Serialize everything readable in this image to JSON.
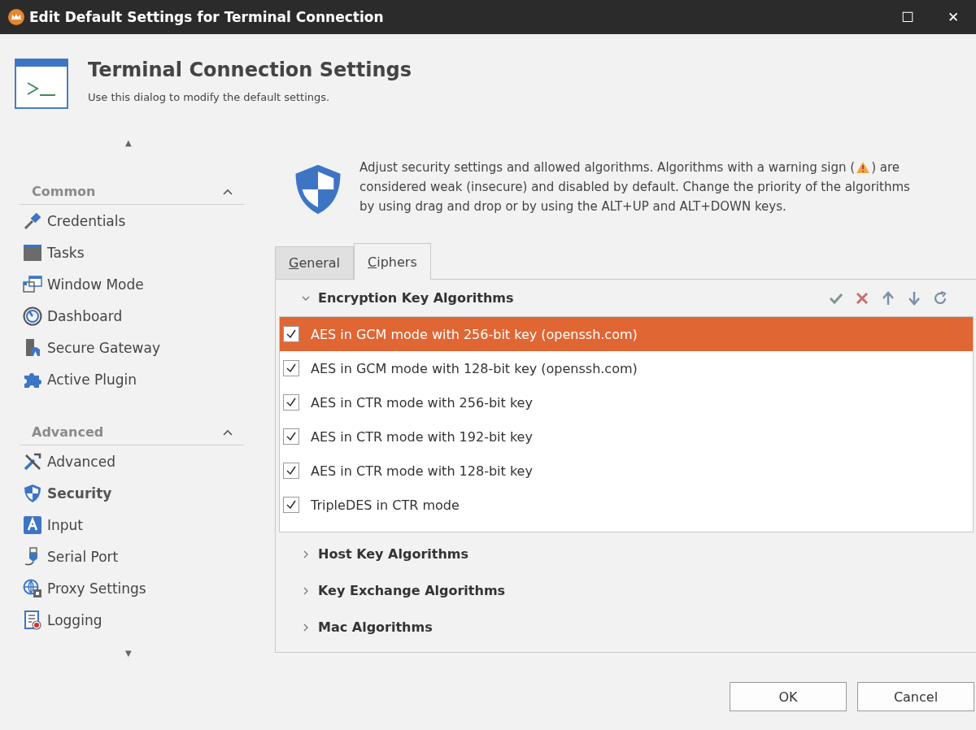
{
  "window": {
    "title": "Edit Default Settings for Terminal Connection",
    "controls": [
      "☐",
      "✕"
    ]
  },
  "header": {
    "title": "Terminal Connection Settings",
    "subtitle": "Use this dialog to modify the default settings."
  },
  "sidebar": {
    "scroll_up": "▲",
    "scroll_down": "▼",
    "groups": [
      {
        "title": "Common",
        "expanded": true,
        "items": [
          {
            "label": "Credentials",
            "selected": false
          },
          {
            "label": "Tasks",
            "selected": false
          },
          {
            "label": "Window Mode",
            "selected": false
          },
          {
            "label": "Dashboard",
            "selected": false
          },
          {
            "label": "Secure Gateway",
            "selected": false
          },
          {
            "label": "Active Plugin",
            "selected": false
          }
        ]
      },
      {
        "title": "Advanced",
        "expanded": true,
        "items": [
          {
            "label": "Advanced",
            "selected": false
          },
          {
            "label": "Security",
            "selected": true
          },
          {
            "label": "Input",
            "selected": false
          },
          {
            "label": "Serial Port",
            "selected": false
          },
          {
            "label": "Proxy Settings",
            "selected": false
          },
          {
            "label": "Logging",
            "selected": false
          }
        ]
      }
    ]
  },
  "intro": {
    "before": "Adjust security settings and allowed algorithms. Algorithms with a warning sign (",
    "after": ") are",
    "lines": [
      "considered weak (insecure) and disabled by default. Change the priority of the algorithms",
      "by using drag and drop or by using the ALT+UP and ALT+DOWN keys."
    ]
  },
  "tabs": [
    {
      "label": "General",
      "selected": false
    },
    {
      "label": "Ciphers",
      "selected": true
    }
  ],
  "sections": [
    {
      "title": "Encryption Key Algorithms",
      "expanded": true,
      "items": [
        {
          "label": "AES in GCM mode with 256-bit key (openssh.com)",
          "checked": true,
          "selected": true
        },
        {
          "label": "AES in GCM mode with 128-bit key (openssh.com)",
          "checked": true,
          "selected": false
        },
        {
          "label": "AES in CTR mode with 256-bit key",
          "checked": true,
          "selected": false
        },
        {
          "label": "AES in CTR mode with 192-bit key",
          "checked": true,
          "selected": false
        },
        {
          "label": "AES in CTR mode with 128-bit key",
          "checked": true,
          "selected": false
        },
        {
          "label": "TripleDES in CTR mode",
          "checked": true,
          "selected": false
        }
      ]
    },
    {
      "title": "Host Key Algorithms",
      "expanded": false
    },
    {
      "title": "Key Exchange Algorithms",
      "expanded": false
    },
    {
      "title": "Mac Algorithms",
      "expanded": false
    }
  ],
  "buttons": [
    "OK",
    "Cancel"
  ]
}
